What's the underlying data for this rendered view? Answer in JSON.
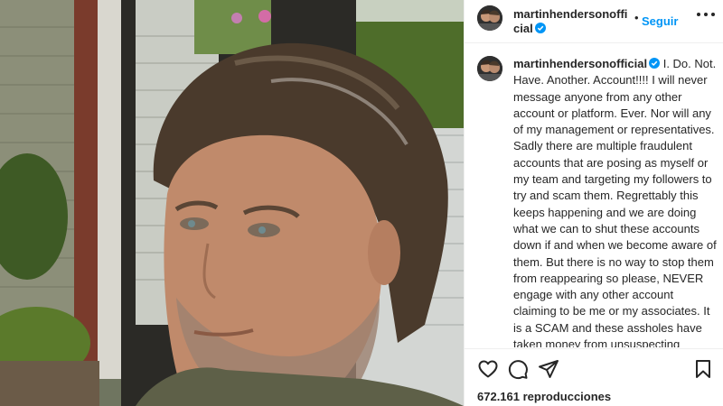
{
  "colors": {
    "accent": "#0095f6",
    "text": "#262626",
    "verified": "#0095f6"
  },
  "media": {
    "description_icon": "photo",
    "content": "selfie-photo"
  },
  "header": {
    "username": "martinhendersonofficial",
    "verified_icon": "verified-badge-icon",
    "separator": "•",
    "follow_label": "Seguir",
    "more_icon": "more-horizontal-icon"
  },
  "caption": {
    "username": "martinhendersonofficial",
    "text": "I. Do. Not. Have. Another. Account!!!! I will never message anyone from any other account or platform. Ever. Nor will any of my management or representatives. Sadly there are multiple fraudulent accounts that are posing as myself or my team and targeting my followers to try and scam them. Regrettably this keeps happening and we are doing what we can to shut these accounts down if and when we become aware of them. But there is no way to stop them from reappearing so please, NEVER engage with any other account claiming to be me or my associates. It is a SCAM and these assholes have taken money from unsuspecting people. I will continue to do what I can but please pass this on to anyone whom you"
  },
  "actions": {
    "like_icon": "heart-icon",
    "comment_icon": "comment-icon",
    "share_icon": "share-icon",
    "save_icon": "bookmark-icon"
  },
  "stats": {
    "views": "672.161 reproducciones"
  }
}
